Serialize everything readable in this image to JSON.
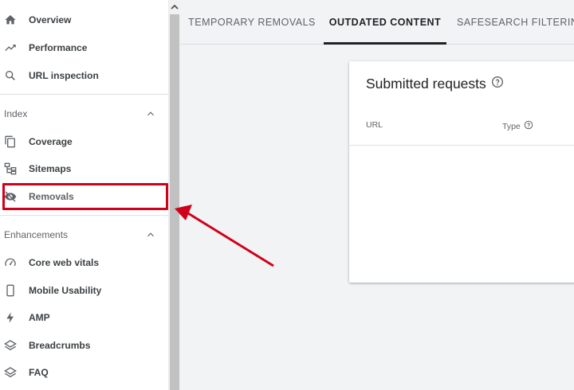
{
  "sidebar": {
    "items_top": [
      {
        "label": "Overview",
        "icon": "home-icon"
      },
      {
        "label": "Performance",
        "icon": "trending-up-icon"
      },
      {
        "label": "URL inspection",
        "icon": "search-icon"
      }
    ],
    "index_section": {
      "title": "Index",
      "items": [
        {
          "label": "Coverage",
          "icon": "copy-icon"
        },
        {
          "label": "Sitemaps",
          "icon": "sitemap-icon"
        },
        {
          "label": "Removals",
          "icon": "eye-off-icon"
        }
      ]
    },
    "enhancements_section": {
      "title": "Enhancements",
      "items": [
        {
          "label": "Core web vitals",
          "icon": "speedometer-icon"
        },
        {
          "label": "Mobile Usability",
          "icon": "phone-icon"
        },
        {
          "label": "AMP",
          "icon": "bolt-icon"
        },
        {
          "label": "Breadcrumbs",
          "icon": "layers-icon"
        },
        {
          "label": "FAQ",
          "icon": "layers-icon"
        }
      ]
    }
  },
  "tabs": [
    {
      "label": "TEMPORARY REMOVALS"
    },
    {
      "label": "OUTDATED CONTENT",
      "active": true
    },
    {
      "label": "SAFESEARCH FILTERING"
    }
  ],
  "card": {
    "title": "Submitted requests",
    "columns": [
      "URL",
      "Type"
    ]
  },
  "colors": {
    "highlight": "#d0021b",
    "text": "#3c4043",
    "muted": "#5f6368"
  }
}
